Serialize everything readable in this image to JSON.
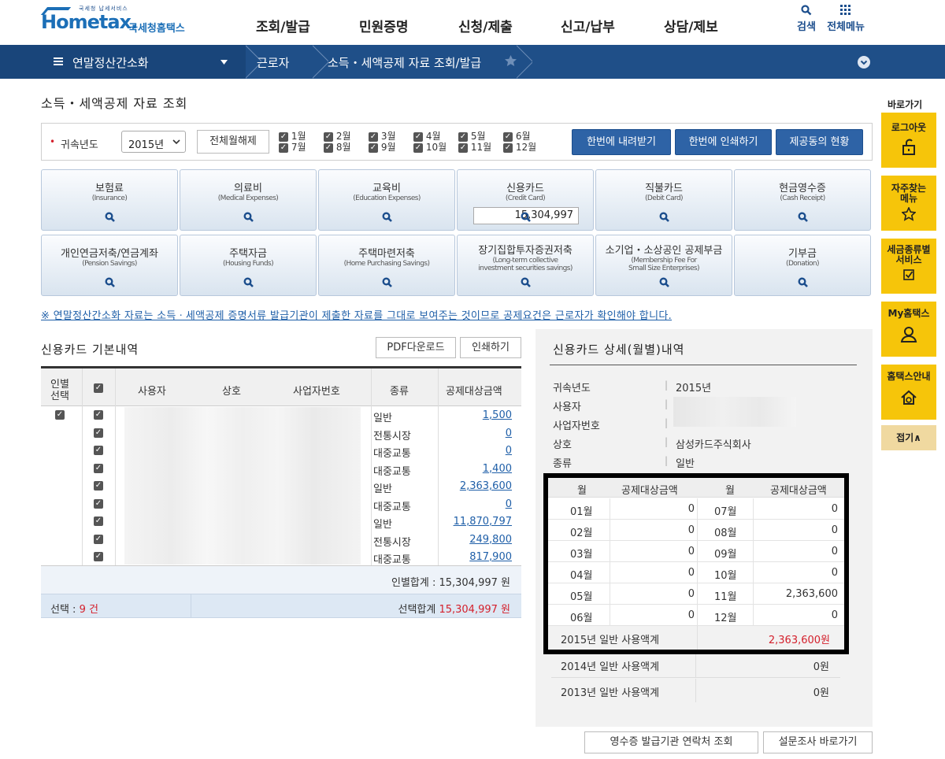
{
  "header": {
    "logo_small": "국세청 납세서비스",
    "logo_text": "Hometax.",
    "logo_kr": "국세청홈택스",
    "gnb": [
      "조회/발급",
      "민원증명",
      "신청/제출",
      "신고/납부",
      "상담/제보"
    ],
    "search": "검색",
    "allmenu": "전체메뉴"
  },
  "nav": {
    "menu": "연말정산간소화",
    "crumb1": "근로자",
    "crumb2": "소득・세액공제 자료 조회/발급"
  },
  "page_title": "소득・세액공제 자료 조회",
  "filter": {
    "year_label": "귀속년도",
    "year_value": "2015년",
    "deselect_all": "전체월해제",
    "months_row1": [
      "1월",
      "2월",
      "3월",
      "4월",
      "5월",
      "6월"
    ],
    "months_row2": [
      "7월",
      "8월",
      "9월",
      "10월",
      "11월",
      "12월"
    ],
    "download_all": "한번에 내려받기",
    "print_all": "한번에 인쇄하기",
    "status": "제공동의 현황"
  },
  "tiles_row1": [
    {
      "k": "보험료",
      "e": "(Insurance)"
    },
    {
      "k": "의료비",
      "e": "(Medical Expenses)"
    },
    {
      "k": "교육비",
      "e": "(Education Expenses)"
    },
    {
      "k": "신용카드",
      "e": "(Credit Card)",
      "amount": "15,304,997"
    },
    {
      "k": "직불카드",
      "e": "(Debit Card)"
    },
    {
      "k": "현금영수증",
      "e": "(Cash Receipt)"
    }
  ],
  "tiles_row2": [
    {
      "k": "개인연금저축/연금계좌",
      "e": "(Pension Savings)"
    },
    {
      "k": "주택자금",
      "e": "(Housing Funds)"
    },
    {
      "k": "주택마련저축",
      "e": "(Home Purchasing Savings)"
    },
    {
      "k": "장기집합투자증권저축",
      "e": "(Long-term collective",
      "e2": "investment securities savings)"
    },
    {
      "k": "소기업・소상공인 공제부금",
      "e": "(Membership Fee For",
      "e2": "Small Size Enterprises)"
    },
    {
      "k": "기부금",
      "e": "(Donation)"
    }
  ],
  "notice": "※ 연말정산간소화 자료는 소득ㆍ세액공제 증명서류 발급기관이 제출한 자료를 그대로 보여주는 것이므로 공제요건은 근로자가 확인해야 합니다.",
  "left": {
    "title": "신용카드 기본내역",
    "pdf": "PDF다운로드",
    "print": "인쇄하기",
    "col_sel1": "인별",
    "col_sel2": "선택",
    "col_user": "사용자",
    "col_shop": "상호",
    "col_biz": "사업자번호",
    "col_type": "종류",
    "col_amt": "공제대상금액",
    "rows": [
      {
        "type": "일반",
        "amt": "1,500"
      },
      {
        "type": "전통시장",
        "amt": "0"
      },
      {
        "type": "대중교통",
        "amt": "0"
      },
      {
        "type": "대중교통",
        "amt": "1,400"
      },
      {
        "type": "일반",
        "amt": "2,363,600"
      },
      {
        "type": "대중교통",
        "amt": "0"
      },
      {
        "type": "일반",
        "amt": "11,870,797"
      },
      {
        "type": "전통시장",
        "amt": "249,800"
      },
      {
        "type": "대중교통",
        "amt": "817,900"
      }
    ],
    "person_total": "인별합계 : 15,304,997 원",
    "sel_label": "선택 : ",
    "sel_count": "9 건",
    "sel_total_label": "선택합계 ",
    "sel_total": "15,304,997 원"
  },
  "right": {
    "title": "신용카드 상세(월별)내역",
    "labels": [
      "귀속년도",
      "사용자",
      "사업자번호",
      "상호",
      "종류"
    ],
    "year": "2015년",
    "shop": "삼성카드주식회사",
    "kind": "일반",
    "th_month": "월",
    "th_amt": "공제대상금액",
    "months": [
      {
        "m1": "01월",
        "a1": "0",
        "m2": "07월",
        "a2": "0"
      },
      {
        "m1": "02월",
        "a1": "0",
        "m2": "08월",
        "a2": "0"
      },
      {
        "m1": "03월",
        "a1": "0",
        "m2": "09월",
        "a2": "0"
      },
      {
        "m1": "04월",
        "a1": "0",
        "m2": "10월",
        "a2": "0"
      },
      {
        "m1": "05월",
        "a1": "0",
        "m2": "11월",
        "a2": "2,363,600"
      },
      {
        "m1": "06월",
        "a1": "0",
        "m2": "12월",
        "a2": "0"
      }
    ],
    "sum2015_label": "2015년 일반 사용액계",
    "sum2015": "2,363,600원",
    "sum2014_label": "2014년 일반 사용액계",
    "sum2014": "0원",
    "sum2013_label": "2013년 일반 사용액계",
    "sum2013": "0원"
  },
  "bottom": {
    "receipt": "영수증 발급기관 연락처 조회",
    "survey": "설문조사 바로가기"
  },
  "side": {
    "title": "바로가기",
    "logout": "로그아웃",
    "fav1": "자주찾는",
    "fav2": "메뉴",
    "tax1": "세금종류별",
    "tax2": "서비스",
    "my": "My홈택스",
    "guide": "홈택스안내",
    "fold": "접기∧"
  }
}
